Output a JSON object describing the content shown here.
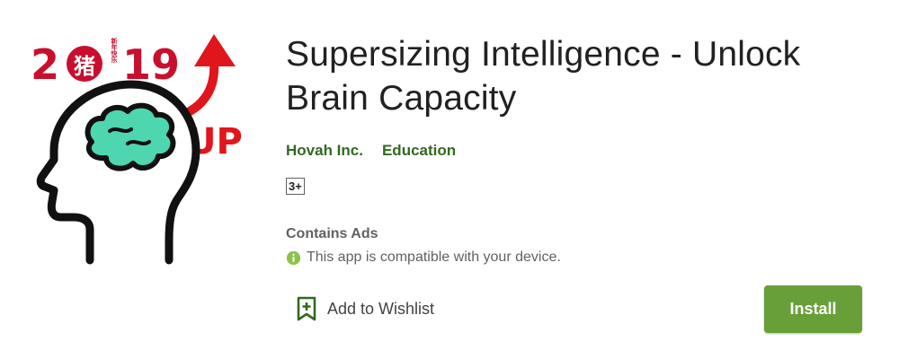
{
  "app": {
    "title": "Supersizing Intelligence - Unlock Brain Capacity",
    "developer": "Hovah Inc.",
    "category": "Education",
    "content_rating": "3+",
    "contains_ads": "Contains Ads",
    "compatibility": "This app is compatible with your device."
  },
  "icon": {
    "year": "2019",
    "glyph": "猪",
    "small_text": "新年快乐",
    "up_text": "UP",
    "red": "#c8102e",
    "brain_color": "#4ed6b0"
  },
  "actions": {
    "wishlist_label": "Add to Wishlist",
    "install_label": "Install"
  },
  "colors": {
    "link_green": "#33691e",
    "install_green": "#689f38",
    "info_icon_green": "#8bc34a"
  }
}
